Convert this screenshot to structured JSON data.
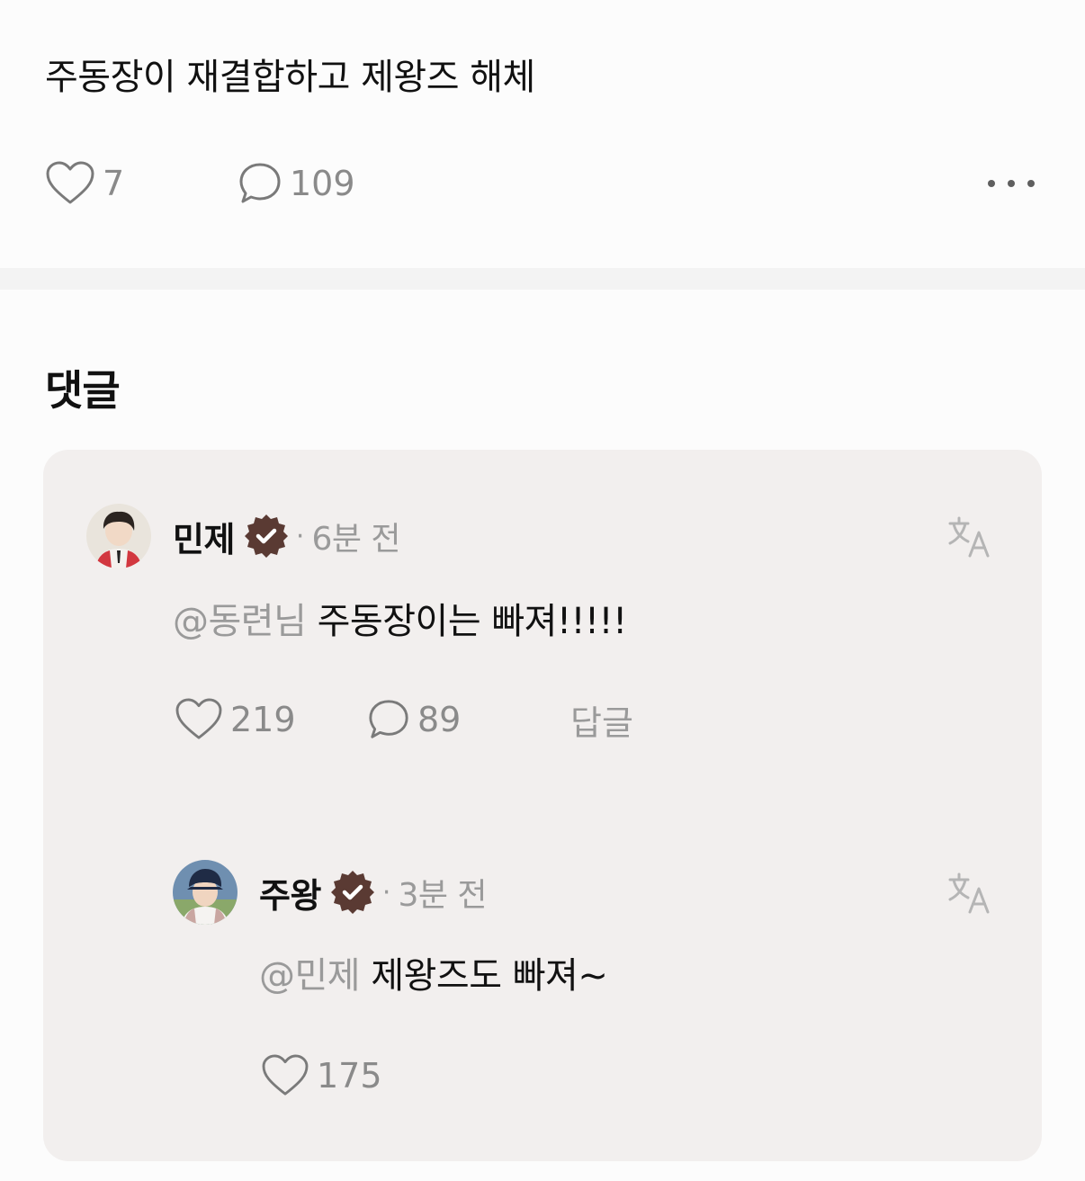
{
  "post": {
    "title": "주동장이 재결합하고 제왕즈 해체",
    "like_count": "7",
    "comment_count": "109",
    "like_icon": "heart-outline-icon",
    "comment_icon": "speech-bubble-icon",
    "more_icon": "more-horizontal-icon"
  },
  "comments_section": {
    "heading": "댓글"
  },
  "comments": [
    {
      "author": "민제",
      "verified": true,
      "separator": "·",
      "time": "6분 전",
      "mention": "@동련님",
      "text": "주동장이는 빠져!!!!!",
      "like_count": "219",
      "reply_count": "89",
      "reply_label": "답글",
      "translate_icon": "translate-icon"
    },
    {
      "author": "주왕",
      "verified": true,
      "separator": "·",
      "time": "3분 전",
      "mention": "@민제",
      "text": "제왕즈도 빠져~",
      "like_count": "175",
      "translate_icon": "translate-icon"
    }
  ],
  "colors": {
    "background": "#fcfcfc",
    "card_background": "#f2efee",
    "badge": "#5a3a33",
    "muted_text": "#9a9a9a",
    "primary_text": "#111111"
  }
}
